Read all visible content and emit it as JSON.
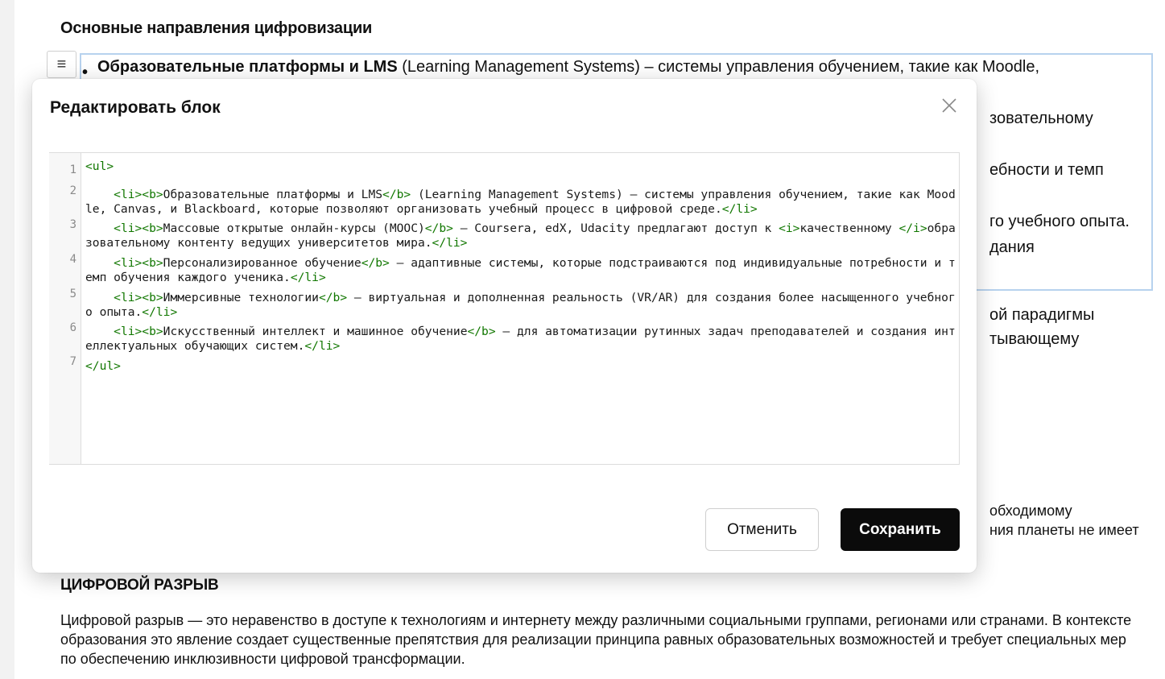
{
  "document": {
    "section_title": "Основные направления цифровизации",
    "handle_icon": "≡",
    "list_first_bold": "Образовательные платформы и LMS",
    "list_first_rest": " (Learning Management Systems) – системы управления обучением, такие как Moodle,",
    "right_fragments": [
      "зовательному",
      "ебности и темп",
      "го учебного опыта.",
      "дания",
      "ой парадигмы",
      "тывающему",
      "обходимому",
      "ния планеты не имеет"
    ],
    "heading2": "ЦИФРОВОЙ РАЗРЫВ",
    "paragraph": "Цифровой разрыв — это неравенство в доступе к технологиям и интернету между различными социальными группами, регионами или странами. В контексте образования это явление создает существенные препятствия для реализации принципа равных образовательных возможностей и требует специальных мер по обеспечению инклюзивности цифровой трансформации."
  },
  "modal": {
    "title": "Редактировать блок",
    "close_icon": "close-icon",
    "cancel_label": "Отменить",
    "save_label": "Сохранить",
    "editor": {
      "line_numbers": [
        "1",
        "2",
        "3",
        "4",
        "5",
        "6",
        "7"
      ],
      "lines": [
        [
          {
            "t": "tag",
            "v": "<ul>"
          }
        ],
        [
          {
            "t": "txt",
            "v": "    "
          },
          {
            "t": "tag",
            "v": "<li><b>"
          },
          {
            "t": "txt",
            "v": "Образовательные платформы и LMS"
          },
          {
            "t": "tag",
            "v": "</b>"
          },
          {
            "t": "txt",
            "v": " (Learning Management Systems) – системы управления обучением, такие как Moodle, Canvas, и Blackboard, которые позволяют организовать учебный процесс в цифровой среде."
          },
          {
            "t": "tag",
            "v": "</li>"
          }
        ],
        [
          {
            "t": "txt",
            "v": "    "
          },
          {
            "t": "tag",
            "v": "<li><b>"
          },
          {
            "t": "txt",
            "v": "Массовые открытые онлайн-курсы (MOOC)"
          },
          {
            "t": "tag",
            "v": "</b>"
          },
          {
            "t": "txt",
            "v": " – Coursera, edX, Udacity предлагают доступ к "
          },
          {
            "t": "tag",
            "v": "<i>"
          },
          {
            "t": "txt",
            "v": "качественному "
          },
          {
            "t": "tag",
            "v": "</i>"
          },
          {
            "t": "txt",
            "v": "образовательному контенту ведущих университетов мира."
          },
          {
            "t": "tag",
            "v": "</li>"
          }
        ],
        [
          {
            "t": "txt",
            "v": "    "
          },
          {
            "t": "tag",
            "v": "<li><b>"
          },
          {
            "t": "txt",
            "v": "Персонализированное обучение"
          },
          {
            "t": "tag",
            "v": "</b>"
          },
          {
            "t": "txt",
            "v": " – адаптивные системы, которые подстраиваются под индивидуальные потребности и темп обучения каждого ученика."
          },
          {
            "t": "tag",
            "v": "</li>"
          }
        ],
        [
          {
            "t": "txt",
            "v": "    "
          },
          {
            "t": "tag",
            "v": "<li><b>"
          },
          {
            "t": "txt",
            "v": "Иммерсивные технологии"
          },
          {
            "t": "tag",
            "v": "</b>"
          },
          {
            "t": "txt",
            "v": " – виртуальная и дополненная реальность (VR/AR) для создания более насыщенного учебного опыта."
          },
          {
            "t": "tag",
            "v": "</li>"
          }
        ],
        [
          {
            "t": "txt",
            "v": "    "
          },
          {
            "t": "tag",
            "v": "<li><b>"
          },
          {
            "t": "txt",
            "v": "Искусственный интеллект и машинное обучение"
          },
          {
            "t": "tag",
            "v": "</b>"
          },
          {
            "t": "txt",
            "v": " – для автоматизации рутинных задач преподавателей и создания интеллектуальных обучающих систем."
          },
          {
            "t": "tag",
            "v": "</li>"
          }
        ],
        [
          {
            "t": "tag",
            "v": "</ul>"
          }
        ]
      ]
    }
  }
}
